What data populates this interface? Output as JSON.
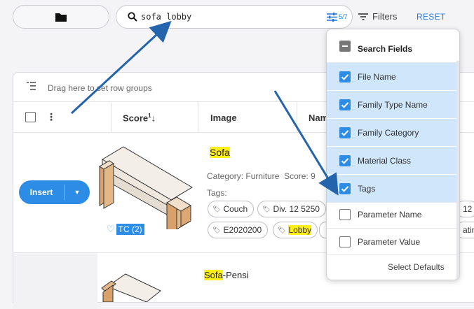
{
  "toolbar": {
    "search_value": "sofa lobby",
    "search_count": "5/7",
    "filters_label": "Filters",
    "reset_label": "RESET"
  },
  "grid": {
    "group_hint": "Drag here to set row groups",
    "columns": {
      "score": "Score",
      "score_sort": "1",
      "image": "Image",
      "name": "Nam"
    }
  },
  "row1": {
    "insert_label": "Insert",
    "tc_label": "TC (2)",
    "title": "Sofa",
    "category": "Category: Furniture",
    "score": "Score: 9",
    "tags_label": "Tags:",
    "tags": [
      "Couch",
      "Div. 12 5250",
      "E2020200",
      "Lobby"
    ],
    "cut_right_1": "12",
    "cut_right_2": "atin"
  },
  "row2": {
    "title_hl": "Sofa",
    "title_rest": "-Pensi"
  },
  "menu": {
    "header": "Search Fields",
    "items": [
      {
        "label": "File Name",
        "checked": true
      },
      {
        "label": "Family Type Name",
        "checked": true
      },
      {
        "label": "Family Category",
        "checked": true
      },
      {
        "label": "Material Class",
        "checked": true
      },
      {
        "label": "Tags",
        "checked": true
      },
      {
        "label": "Parameter Name",
        "checked": false
      },
      {
        "label": "Parameter Value",
        "checked": false
      }
    ],
    "footer": "Select Defaults"
  },
  "colors": {
    "accent": "#2d8ce6",
    "highlight": "#ffef1a",
    "selected_bg": "#cfe6fb",
    "annotation": "#2464ad"
  }
}
